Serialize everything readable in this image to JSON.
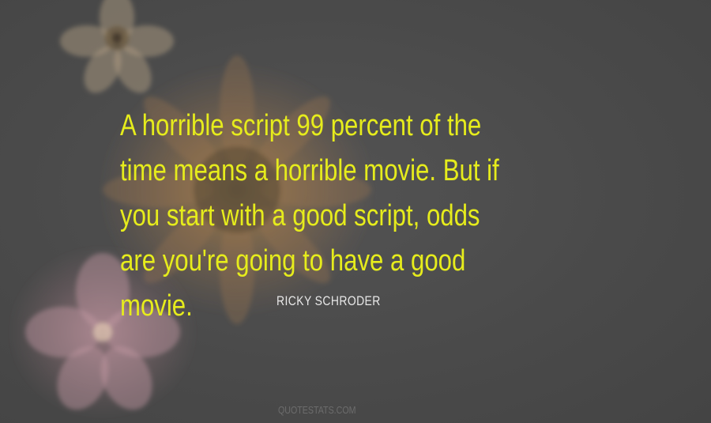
{
  "quote": {
    "lines": [
      "A horrible script 99 percent of the",
      "time means a horrible movie. But if",
      "you start with a good script, odds",
      "are you're going to have a good",
      "movie."
    ]
  },
  "author": "RICKY SCHRODER",
  "site": "QUOTESTATS.COM",
  "colors": {
    "background": "#4b4b4b",
    "quote_text": "#e6ec1c",
    "author_text": "#e8e8e8",
    "site_text": "#6c6c6c"
  }
}
